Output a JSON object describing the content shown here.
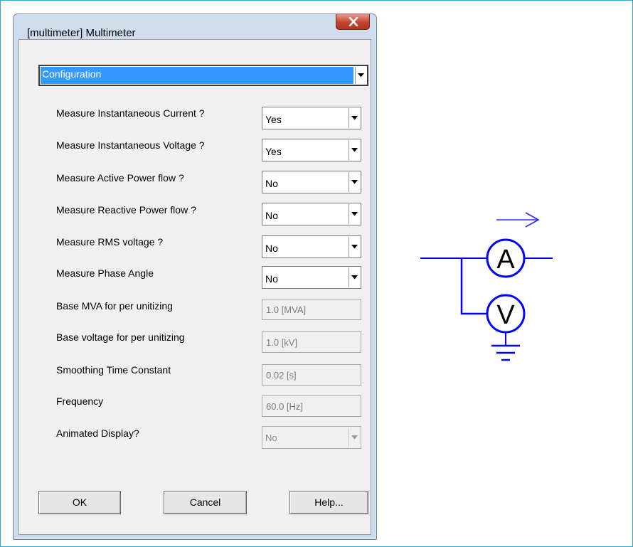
{
  "window": {
    "title": "[multimeter] Multimeter",
    "close_icon": "close-x-icon"
  },
  "section_select": {
    "value": "Configuration"
  },
  "settings": [
    {
      "label": "Measure Instantaneous Current ?",
      "value": "Yes"
    },
    {
      "label": "Measure Instantaneous Voltage ?",
      "value": "Yes"
    },
    {
      "label": "Measure Active Power flow ?",
      "value": "No"
    },
    {
      "label": "Measure Reactive Power flow ?",
      "value": "No"
    },
    {
      "label": "Measure RMS voltage ?",
      "value": "No"
    },
    {
      "label": "Measure Phase Angle",
      "value": "No"
    }
  ],
  "fields": [
    {
      "label": "Base MVA for per unitizing",
      "value": "1.0 [MVA]"
    },
    {
      "label": "Base voltage for per unitizing",
      "value": "1.0 [kV]"
    },
    {
      "label": "Smoothing Time Constant",
      "value": "0.02 [s]"
    },
    {
      "label": "Frequency",
      "value": "60.0 [Hz]"
    }
  ],
  "animated": {
    "label": "Animated Display?",
    "value": "No"
  },
  "buttons": {
    "ok": "OK",
    "cancel": "Cancel",
    "help": "Help..."
  },
  "diagram": {
    "ammeter_letter": "A",
    "voltmeter_letter": "V",
    "line_color": "#0000ff",
    "arrow_color": "#2a2aff"
  },
  "colors": {
    "frame_border": "#2aa8d6",
    "selection_highlight": "#3399ff",
    "close_button": "#c4442c"
  }
}
